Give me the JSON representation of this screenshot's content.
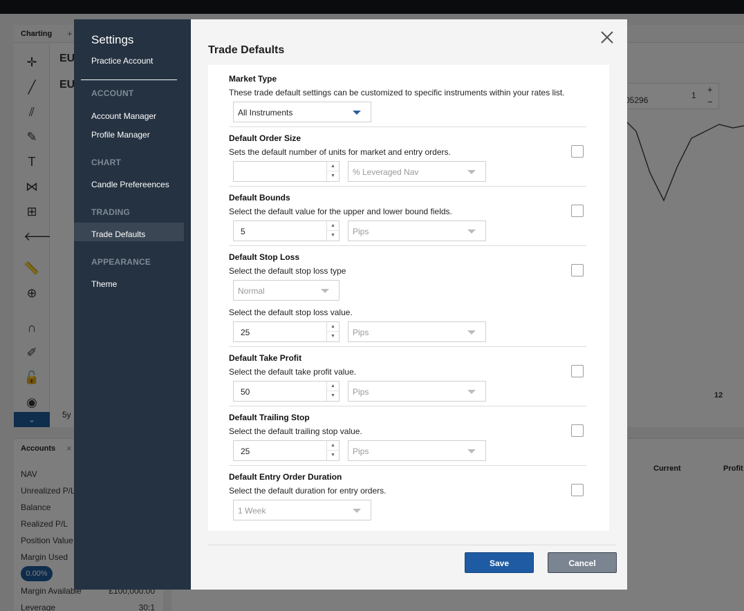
{
  "background": {
    "tab": "Charting",
    "tab_plus": "+",
    "pair_1": "EU",
    "pair_2": "EU",
    "period": "5y",
    "quote_price": "05296",
    "quote_qty": "1",
    "axis_label": "12",
    "accounts": {
      "title": "Accounts",
      "rows": [
        "NAV",
        "Unrealized P/L",
        "Balance",
        "Realized P/L",
        "Position Value",
        "Margin Used",
        "Margin Available",
        "Leverage"
      ],
      "margin_badge": "0.00%",
      "margin_available_value": "£100,000.00",
      "leverage_value": "30:1"
    },
    "columns": [
      "Current",
      "Profit"
    ]
  },
  "sidebar": {
    "title": "Settings",
    "account": "Practice Account",
    "sections": [
      {
        "heading": "ACCOUNT",
        "items": [
          "Account Manager",
          "Profile Manager"
        ]
      },
      {
        "heading": "CHART",
        "items": [
          "Candle Prefereences"
        ]
      },
      {
        "heading": "TRADING",
        "items": [
          "Trade Defaults"
        ]
      },
      {
        "heading": "APPEARANCE",
        "items": [
          "Theme"
        ]
      }
    ],
    "active_item": "Trade Defaults"
  },
  "modal": {
    "title": "Trade Defaults",
    "market_type": {
      "title": "Market Type",
      "description": "These trade default settings can be customized to specific instruments within your rates list.",
      "selected": "All Instruments"
    },
    "order_size": {
      "title": "Default Order Size",
      "description": "Sets the default number of units for market and entry orders.",
      "value": "",
      "unit": "% Leveraged Nav",
      "checked": false
    },
    "bounds": {
      "title": "Default Bounds",
      "description": "Select the default value for the upper and lower bound fields.",
      "value": "5",
      "unit": "Pips",
      "checked": false
    },
    "stop_loss": {
      "title": "Default Stop Loss",
      "description": "Select the default stop loss type",
      "type": "Normal",
      "value_description": "Select the default stop loss value.",
      "value": "25",
      "unit": "Pips",
      "checked": false
    },
    "take_profit": {
      "title": "Default Take Profit",
      "description": "Select the default take profit value.",
      "value": "50",
      "unit": "Pips",
      "checked": false
    },
    "trailing_stop": {
      "title": "Default Trailing Stop",
      "description": "Select the default trailing stop value.",
      "value": "25",
      "unit": "Pips",
      "checked": false
    },
    "entry_duration": {
      "title": "Default Entry Order Duration",
      "description": "Select the default duration for entry orders.",
      "selected": "1 Week",
      "checked": false
    },
    "save_label": "Save",
    "cancel_label": "Cancel"
  },
  "colors": {
    "sidebar_bg": "#253241",
    "save": "#1e5ba3",
    "cancel": "#7b8591"
  }
}
